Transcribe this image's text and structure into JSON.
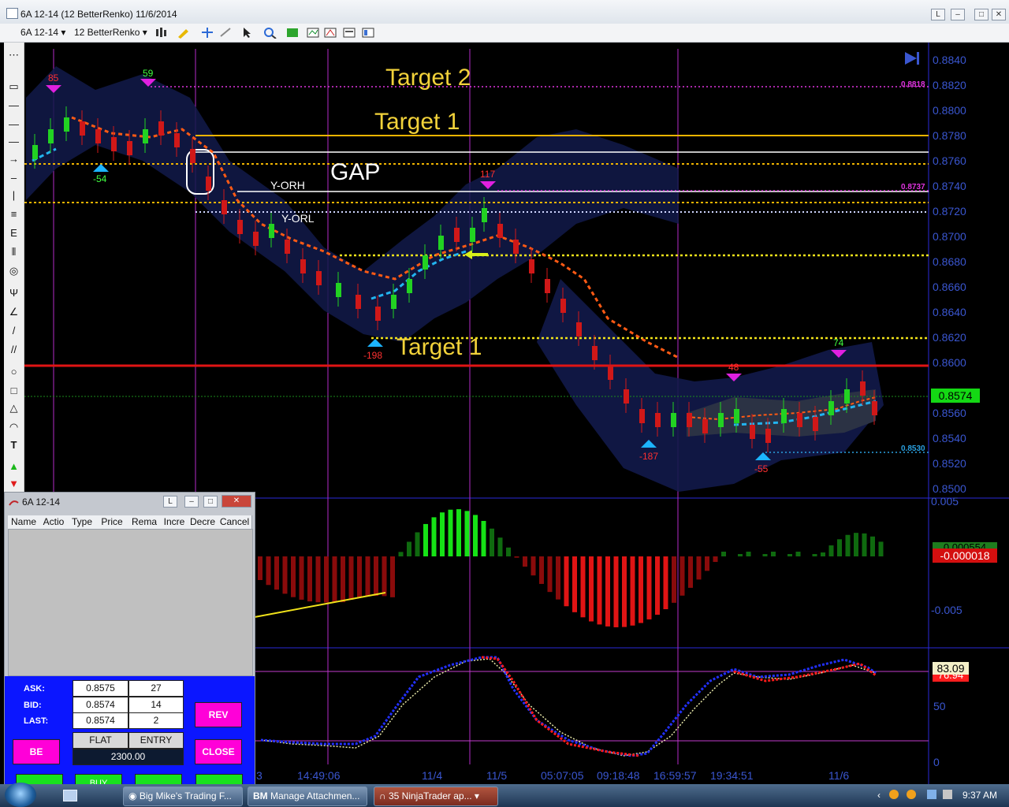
{
  "window": {
    "title": "6A 12-14 (12 BetterRenko)  11/6/2014",
    "buttons": [
      "L",
      "–",
      "□",
      "✕"
    ]
  },
  "toolbar": {
    "instrument": "6A 12-14",
    "bar_type": "12 BetterRenko"
  },
  "chart": {
    "price_labels": [
      "0.8840",
      "0.8820",
      "0.8800",
      "0.8780",
      "0.8760",
      "0.8740",
      "0.8720",
      "0.8700",
      "0.8680",
      "0.8660",
      "0.8640",
      "0.8620",
      "0.8600",
      "0.8560",
      "0.8540",
      "0.8520",
      "0.8500"
    ],
    "level_labels": {
      "l1": "0.8818",
      "l2": "0.8737",
      "l3": "0.8530"
    },
    "last_price": "0.8574",
    "annotations": {
      "target2": "Target 2",
      "target1a": "Target 1",
      "gap": "GAP",
      "target1b": "Target 1",
      "yorh": "Y-ORH",
      "yorl": "Y-ORL"
    },
    "markers": {
      "m85": "85",
      "m59": "59",
      "m117": "117",
      "m48": "48",
      "m74": "74",
      "mneg54": "-54",
      "mneg198": "-198",
      "mneg187": "-187",
      "mneg55": "-55"
    },
    "macd_labels": {
      "top": "0.005",
      "mid": "-0.005",
      "box1": "0.000554",
      "box2": "-0.000018"
    },
    "stoch_labels": {
      "v50": "50",
      "v0": "0",
      "box1": "83.09",
      "box2": "76.94"
    },
    "time_labels": [
      "3",
      "14:49:06",
      "11/4",
      "11/5",
      "05:07:05",
      "09:18:48",
      "16:59:57",
      "19:34:51",
      "11/6"
    ]
  },
  "order_window": {
    "title": "6A 12-14",
    "columns": [
      "Name",
      "Actio",
      "Type",
      "Price",
      "Rema",
      "Incre",
      "Decre",
      "Cancel"
    ],
    "ask_label": "ASK:",
    "ask_price": "0.8575",
    "ask_size": "27",
    "bid_label": "BID:",
    "bid_price": "0.8574",
    "bid_size": "14",
    "last_label": "LAST:",
    "last_price": "0.8574",
    "last_size": "2",
    "rev_label": "REV",
    "be_label": "BE",
    "close_label": "CLOSE",
    "position": "FLAT",
    "entry": "ENTRY",
    "pnl": "2300.00",
    "bottom_buttons": [
      "...",
      "BUY",
      "...",
      "..."
    ]
  },
  "taskbar": {
    "tasks": [
      "Big Mike's Trading F...",
      "Manage Attachmen...",
      "35 NinjaTrader ap..."
    ],
    "clock": "9:37 AM"
  }
}
